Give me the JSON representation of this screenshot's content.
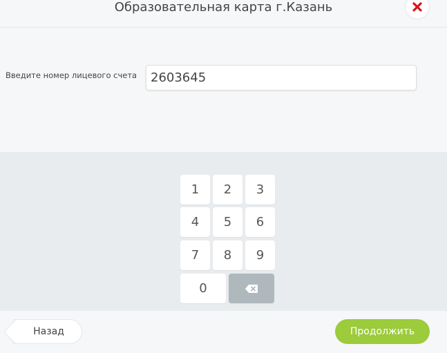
{
  "header": {
    "title": "Образовательная карта г.Казань",
    "close_icon": "close-icon",
    "close_color": "#d7141a"
  },
  "form": {
    "label": "Введите номер лицевого счета",
    "account_value": "2603645"
  },
  "keypad": {
    "keys": [
      "1",
      "2",
      "3",
      "4",
      "5",
      "6",
      "7",
      "8",
      "9",
      "0"
    ],
    "backspace_icon": "backspace-icon"
  },
  "footer": {
    "back_label": "Назад",
    "continue_label": "Продолжить",
    "continue_color": "#9ccb3b"
  }
}
